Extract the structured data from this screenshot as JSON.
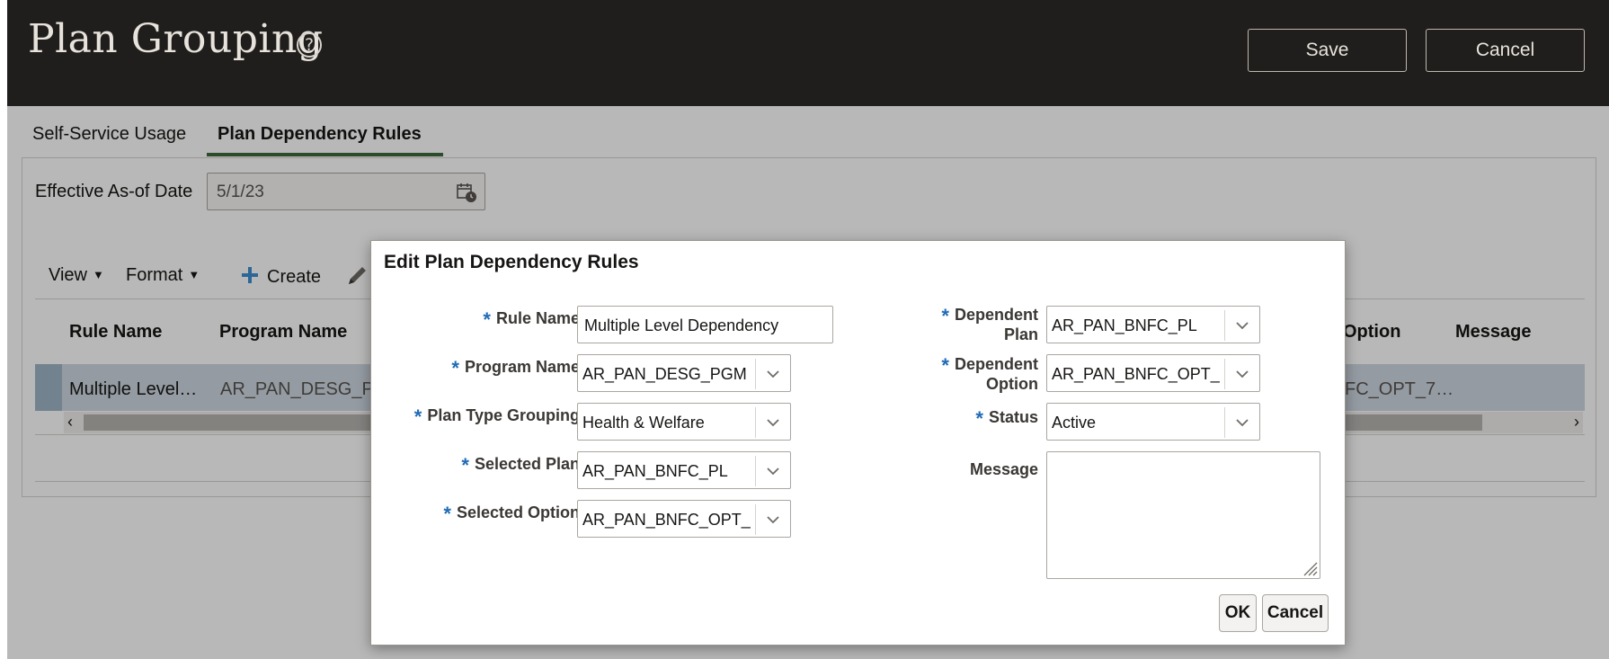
{
  "header": {
    "title": "Plan Grouping",
    "help_icon": "help-circle-icon",
    "save_label": "Save",
    "cancel_label": "Cancel"
  },
  "tabs": [
    {
      "label": "Self-Service Usage",
      "active": false
    },
    {
      "label": "Plan Dependency Rules",
      "active": true
    }
  ],
  "effective_date": {
    "label": "Effective As-of Date",
    "value": "5/1/23",
    "icon": "calendar-icon"
  },
  "toolbar": {
    "view_label": "View",
    "format_label": "Format",
    "create_label": "Create",
    "edit_icon": "pencil-icon"
  },
  "table": {
    "columns": [
      "Rule Name",
      "Program Name",
      "Option",
      "Message"
    ],
    "row": {
      "rule_name": "Multiple Level…",
      "program_name": "AR_PAN_DESG_PG",
      "option": "FC_OPT_7…",
      "message": ""
    }
  },
  "dialog": {
    "title": "Edit Plan Dependency Rules",
    "fields": {
      "rule_name": {
        "label": "Rule Name",
        "value": "Multiple Level Dependency"
      },
      "program_name": {
        "label": "Program Name",
        "value": "AR_PAN_DESG_PGM"
      },
      "plan_type_grouping": {
        "label": "Plan Type Grouping",
        "value": "Health & Welfare"
      },
      "selected_plan": {
        "label": "Selected Plan",
        "value": "AR_PAN_BNFC_PL"
      },
      "selected_option": {
        "label": "Selected Option",
        "value": "AR_PAN_BNFC_OPT_"
      },
      "dependent_plan": {
        "label_line1": "Dependent",
        "label_line2": "Plan",
        "value": "AR_PAN_BNFC_PL"
      },
      "dependent_option": {
        "label_line1": "Dependent",
        "label_line2": "Option",
        "value": "AR_PAN_BNFC_OPT_"
      },
      "status": {
        "label": "Status",
        "value": "Active"
      },
      "message": {
        "label": "Message",
        "value": ""
      }
    },
    "ok_label": "OK",
    "cancel_label": "Cancel"
  },
  "colors": {
    "header_bg": "#201e1c",
    "required_asterisk": "#1f6bb6",
    "active_tab_underline": "#3d6b3a",
    "selected_row": "#cdd7e1"
  }
}
